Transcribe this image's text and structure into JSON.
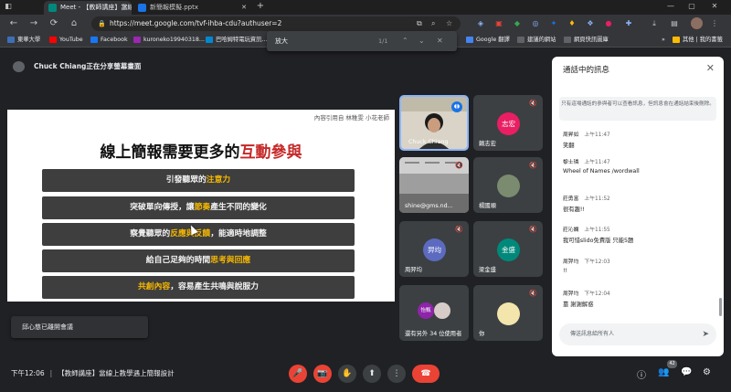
{
  "browser": {
    "tabs": [
      {
        "label": "Meet - 【教師講座】當線上",
        "active": true
      },
      {
        "label": "新簡報模擬.pptx",
        "active": false
      }
    ],
    "new_tab": "+",
    "url": "https://meet.google.com/tvf-ihba-cdu?authuser=2",
    "bookmarks": [
      "東華大學",
      "YouTube",
      "Facebook",
      "kuroneko19940318...",
      "巴哈姆特電玩資訊...",
      "Google 翻譯",
      "建議的網站",
      "網頁快訊圖庫",
      "其他 | 我的書籤"
    ],
    "find": {
      "query": "放大",
      "count": "1/1"
    }
  },
  "meeting": {
    "presenter_notice": "Chuck Chiang正在分享螢幕畫面",
    "time": "下午12:06",
    "title": "【教師講座】當線上教學遇上簡報設計",
    "leave_toast": "邱心慈已離開會議"
  },
  "slide": {
    "credit": "內容引用自 林稚雯 小花老師",
    "title_a": "線上簡報需要更多的",
    "title_b": "互動參與",
    "bars": [
      {
        "pre": "引發聽眾的",
        "hl": "注意力",
        "post": ""
      },
      {
        "pre": "突破單向傳授，讓",
        "hl": "節奏",
        "post": "產生不同的變化"
      },
      {
        "pre": "察覺聽眾的",
        "hl": "反應與反饋",
        "post": "，能適時地調整"
      },
      {
        "pre": "給自己足夠的時間",
        "hl": "思考與回應",
        "post": ""
      },
      {
        "pre": "",
        "hl": "共創內容",
        "post": "，容易產生共鳴與說服力"
      }
    ]
  },
  "participants": [
    {
      "name": "Chuck Chiang",
      "avatar": ""
    },
    {
      "name": "賴志宏",
      "avatar": "志宏"
    },
    {
      "name": "shine@gms.nd...",
      "avatar": ""
    },
    {
      "name": "楊國順",
      "avatar": ""
    },
    {
      "name": "周羿均",
      "avatar": "羿均"
    },
    {
      "name": "梁金盛",
      "avatar": "金盛"
    },
    {
      "name": "還有另外 34 位使用者",
      "avatar": "怡甄"
    },
    {
      "name": "你",
      "avatar": ""
    }
  ],
  "chat": {
    "header": "通話中的訊息",
    "note": "只有這場通話的參與者可以查看訊息，但訊息會在通話結束後刪除。",
    "messages": [
      {
        "who": "周昇如",
        "time": "上午11:47",
        "text": "笑翻"
      },
      {
        "who": "黎士璘",
        "time": "上午11:47",
        "text": "Wheel of Names /wordwall"
      },
      {
        "who": "莊勇富",
        "time": "上午11:52",
        "text": "很有趣!!"
      },
      {
        "who": "莊沁嫻",
        "time": "上午11:55",
        "text": "我可惜slido免費版 只能5題"
      },
      {
        "who": "周羿均",
        "time": "下午12:03",
        "text": "!!"
      },
      {
        "who": "周羿均",
        "time": "下午12:04",
        "text": "靠 謝謝解惑"
      }
    ],
    "input_placeholder": "傳送訊息給所有人"
  },
  "controls": {
    "mic": "🎤",
    "cam": "📷",
    "hand": "✋",
    "present": "⬆",
    "more": "⋮",
    "hangup": "☎",
    "info": "ⓘ",
    "people": "👥",
    "people_count": "42",
    "chat": "💬",
    "activities": "⚙"
  },
  "colors": {
    "accent_red": "#ea4335",
    "meet_bg": "#202124",
    "slide_highlight": "#f5b700",
    "title_red": "#c62828"
  }
}
